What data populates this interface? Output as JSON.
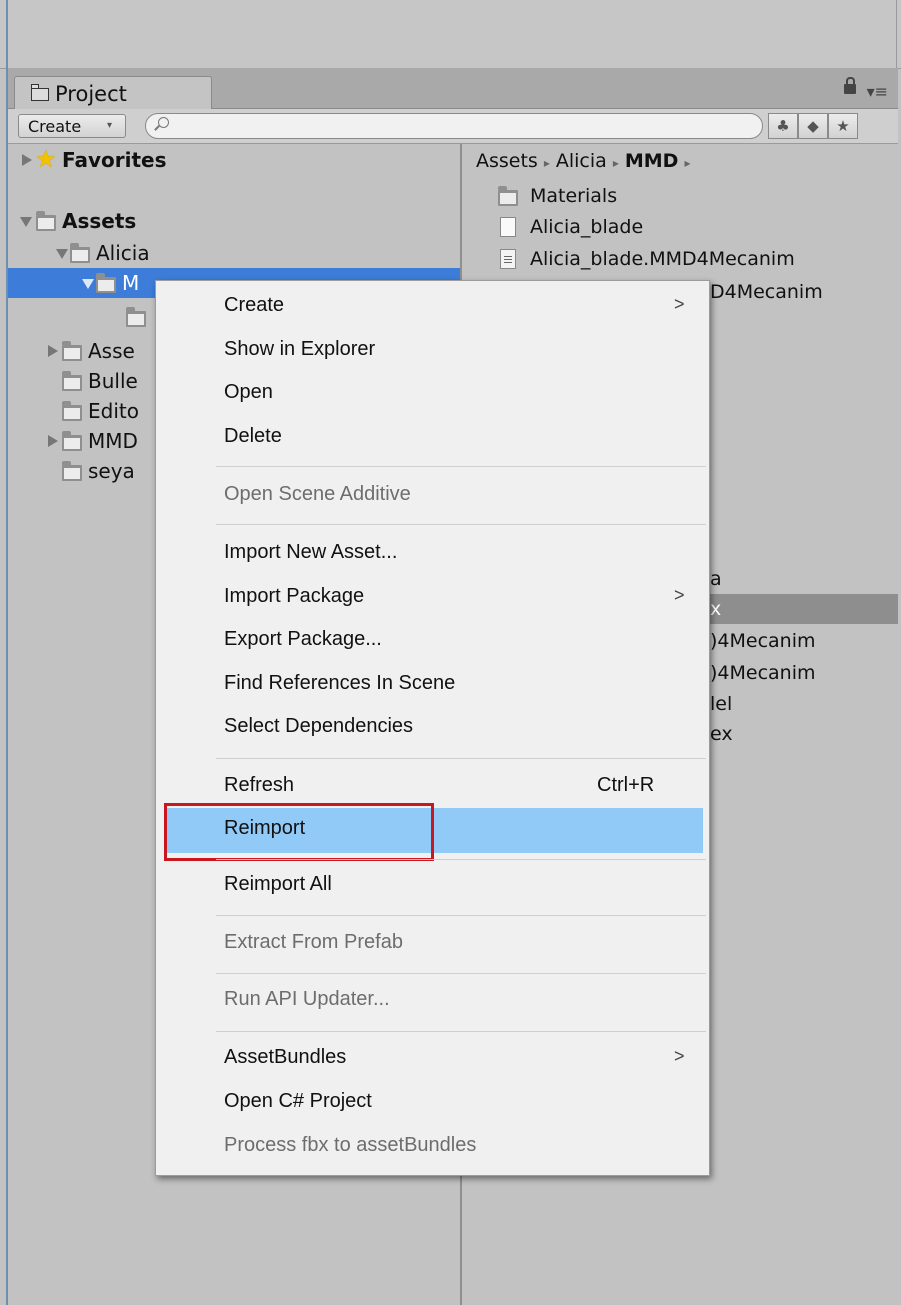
{
  "panel": {
    "tab_label": "Project",
    "lock_icon": "lock-icon",
    "menu_icon": "panel-menu-icon",
    "menu_glyph": "▾≡"
  },
  "toolbar": {
    "create_label": "Create",
    "create_arrow": "▾",
    "search_placeholder": "",
    "filter_type_glyph": "♣",
    "filter_label_glyph": "◆",
    "favorite_glyph": "★"
  },
  "tree": {
    "favorites": "Favorites",
    "assets": "Assets",
    "alicia": "Alicia",
    "mmd_selected": "M",
    "child_truncated": "",
    "asse": "Asse",
    "bulle": "Bulle",
    "edito": "Edito",
    "mmd2": "MMD",
    "seya": "seya"
  },
  "breadcrumb": {
    "part1": "Assets",
    "part2": "Alicia",
    "part3": "MMD",
    "sep": "▸"
  },
  "files": {
    "f1": "Materials",
    "f2": "Alicia_blade",
    "f3": "Alicia_blade.MMD4Mecanim",
    "f4": "D4Mecanim",
    "f5": "a",
    "f6": "x",
    "f7": ")4Mecanim",
    "f8": ")4Mecanim",
    "f9": "lel",
    "f10": "ex"
  },
  "menu": {
    "create": "Create",
    "show_in_explorer": "Show in Explorer",
    "open": "Open",
    "delete": "Delete",
    "open_scene_additive": "Open Scene Additive",
    "import_new_asset": "Import New Asset...",
    "import_package": "Import Package",
    "export_package": "Export Package...",
    "find_references": "Find References In Scene",
    "select_dependencies": "Select Dependencies",
    "refresh": "Refresh",
    "refresh_shortcut": "Ctrl+R",
    "reimport": "Reimport",
    "reimport_all": "Reimport All",
    "extract_from_prefab": "Extract From Prefab",
    "run_api_updater": "Run API Updater...",
    "asset_bundles": "AssetBundles",
    "open_csharp": "Open C# Project",
    "process_fbx": "Process fbx to assetBundles",
    "submenu_arrow": ">"
  },
  "colors": {
    "selection_blue": "#3d7cd8",
    "menu_highlight": "#91c9f7",
    "annotation_red": "#c8171f"
  }
}
